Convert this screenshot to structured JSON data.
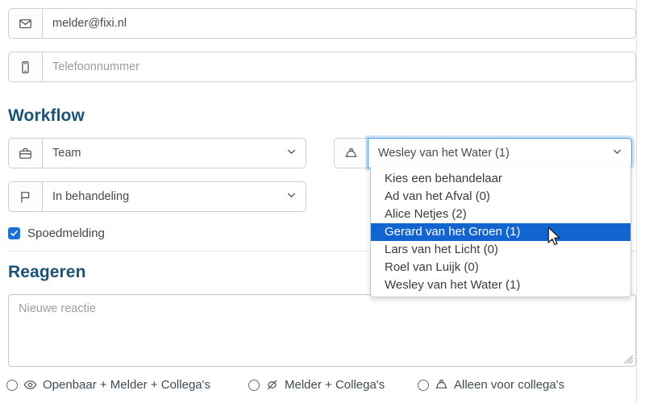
{
  "contact": {
    "email": {
      "icon": "envelope-icon",
      "value": "melder@fixi.nl"
    },
    "phone": {
      "icon": "mobile-phone-icon",
      "placeholder": "Telefoonnummer"
    }
  },
  "workflow": {
    "heading": "Workflow",
    "team_select": {
      "icon": "briefcase-icon",
      "value": "Team"
    },
    "status_select": {
      "icon": "flag-icon",
      "value": "In behandeling"
    },
    "handler_select": {
      "icon": "hard-hat-icon",
      "value": "Wesley van het Water (1)",
      "focused": true,
      "options": [
        {
          "label": "Kies een behandelaar",
          "selected": false
        },
        {
          "label": "Ad van het Afval (0)",
          "selected": false
        },
        {
          "label": "Alice Netjes (2)",
          "selected": false
        },
        {
          "label": "Gerard van het Groen (1)",
          "selected": true
        },
        {
          "label": "Lars van het Licht (0)",
          "selected": false
        },
        {
          "label": "Roel van Luijk (0)",
          "selected": false
        },
        {
          "label": "Wesley van het Water (1)",
          "selected": false
        }
      ]
    },
    "urgent_checkbox": {
      "label": "Spoedmelding",
      "checked": true
    }
  },
  "reply": {
    "heading": "Reageren",
    "comment_placeholder": "Nieuwe reactie",
    "visibility_options": [
      {
        "label": "Openbaar + Melder + Collega's",
        "icon": "eye-icon",
        "selected": false
      },
      {
        "label": "Melder + Collega's",
        "icon": "eye-off-icon",
        "selected": false
      },
      {
        "label": "Alleen voor collega's",
        "icon": "hard-hat-icon",
        "selected": false
      }
    ]
  },
  "colors": {
    "heading": "#1b5276",
    "accent": "#1265d0",
    "checkbox": "#1a73d4",
    "focus_border": "#4a9ae8"
  }
}
